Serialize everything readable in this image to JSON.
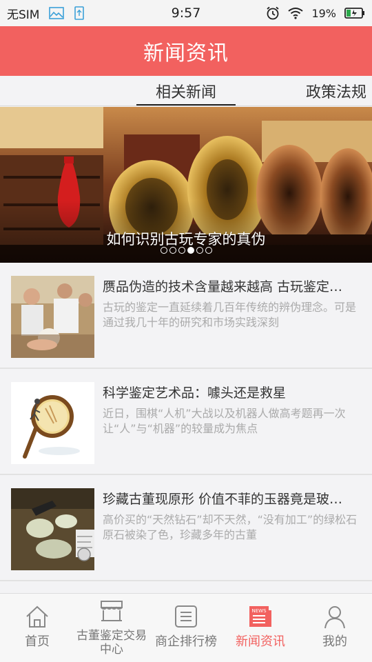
{
  "status_bar": {
    "carrier": "无SIM",
    "time": "9:57",
    "battery": "19%",
    "icons": [
      "image-icon",
      "usb-icon",
      "alarm-icon",
      "wifi-icon",
      "battery-icon"
    ]
  },
  "header": {
    "title": "新闻资讯"
  },
  "tabs": [
    {
      "label": "相关新闻",
      "active": true
    },
    {
      "label": "政策法规",
      "active": false
    }
  ],
  "banner": {
    "caption": "如何识别古玩专家的真伪",
    "slide_count": 6,
    "active_index": 3
  },
  "news": [
    {
      "title": "赝品伪造的技术含量越来越高 古玩鉴定…",
      "summary": "古玩的鉴定一直延续着几百年传统的辨伪理念。可是通过我几十年的研究和市场实践深刻"
    },
    {
      "title": "科学鉴定艺术品：噱头还是救星",
      "summary": "近日，围棋“人机”大战以及机器人做高考题再一次让“人”与“机器”的较量成为焦点"
    },
    {
      "title": "珍藏古董现原形 价值不菲的玉器竟是玻…",
      "summary": "高价买的“天然钻石”却不天然，“没有加工”的绿松石原石被染了色，珍藏多年的古董"
    }
  ],
  "bottom_nav": [
    {
      "label": "首页",
      "icon": "home-icon",
      "active": false
    },
    {
      "label": "古董鉴定交易中心",
      "icon": "store-icon",
      "active": false
    },
    {
      "label": "商企排行榜",
      "icon": "list-icon",
      "active": false
    },
    {
      "label": "新闻资讯",
      "icon": "news-icon",
      "active": true
    },
    {
      "label": "我的",
      "icon": "profile-icon",
      "active": false
    }
  ],
  "colors": {
    "accent": "#f2615f",
    "background": "#f3f3f5"
  }
}
